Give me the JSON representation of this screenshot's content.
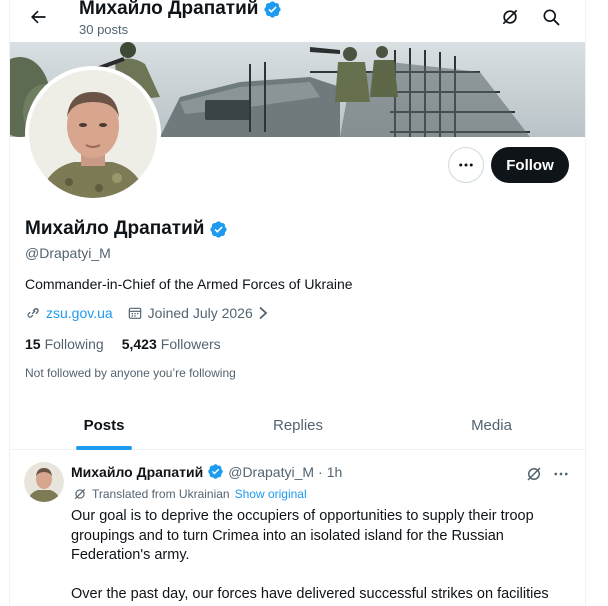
{
  "header": {
    "name": "Михайло Драпатий",
    "posts_count": "30 posts",
    "back_icon": "arrow-left-icon",
    "translate_icon": "translate-off-icon",
    "search_icon": "search-icon"
  },
  "profile": {
    "name": "Михайло Драпатий",
    "handle": "@Drapatyi_M",
    "bio": "Commander-in-Chief of the Armed Forces of Ukraine",
    "website": "zsu.gov.ua",
    "joined": "Joined July 2026",
    "following_count": "15",
    "following_label": "Following",
    "followers_count": "5,423",
    "followers_label": "Followers",
    "not_followed": "Not followed by anyone you’re following"
  },
  "actions": {
    "follow_label": "Follow"
  },
  "tabs": [
    {
      "label": "Posts",
      "active": true
    },
    {
      "label": "Replies",
      "active": false
    },
    {
      "label": "Media",
      "active": false
    }
  ],
  "tweet": {
    "name": "Михайло Драпатий",
    "handle": "@Drapatyi_M",
    "dot": "·",
    "time": "1h",
    "translated": "Translated from Ukrainian",
    "show_original": "Show original",
    "paragraph1": "Our goal is to deprive the occupiers of opportunities to supply their troop groupings and to turn Crimea into an isolated island for the Russian Federation's army.",
    "paragraph2": "Over the past day, our forces have delivered successful strikes on facilities"
  },
  "colors": {
    "accent": "#1d9bf0",
    "text": "#0f1419",
    "secondary": "#536471",
    "follow_bg": "#0f1419"
  }
}
